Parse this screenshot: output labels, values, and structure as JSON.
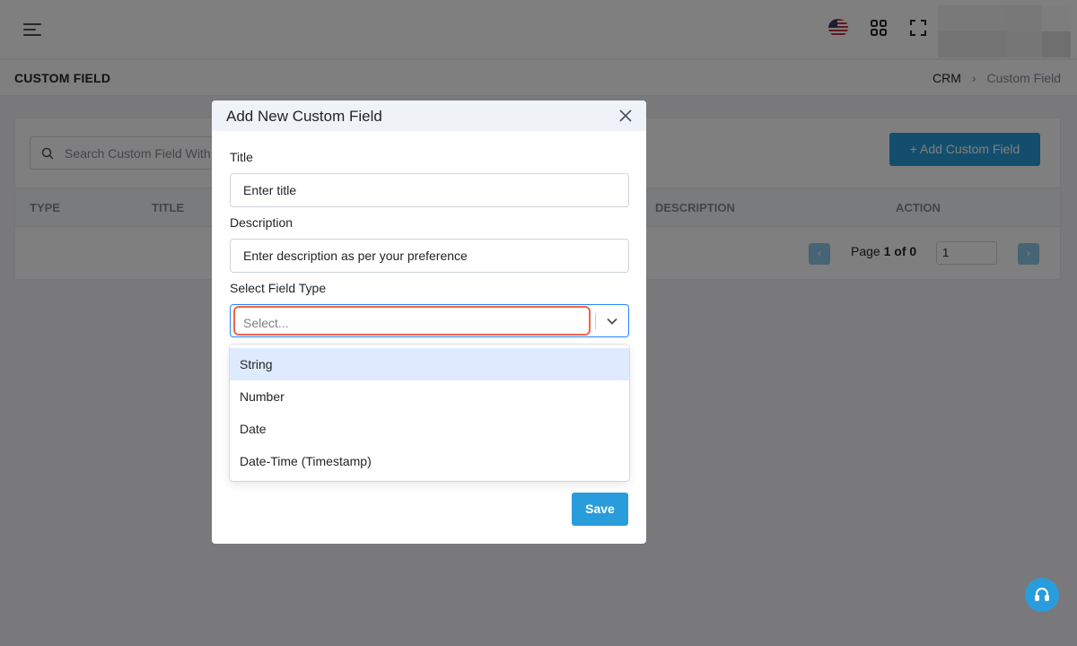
{
  "topbar": {
    "menu_icon": "hamburger-icon",
    "language_flag": "us-flag-icon",
    "apps_icon": "apps-grid-icon",
    "fullscreen_icon": "fullscreen-icon"
  },
  "page": {
    "title": "CUSTOM FIELD",
    "breadcrumb": [
      "CRM",
      "Custom Field"
    ]
  },
  "card": {
    "search_placeholder": "Search Custom Field With...",
    "add_button": "+ Add Custom Field",
    "columns": [
      "TYPE",
      "TITLE",
      "DESCRIPTION",
      "ACTION"
    ],
    "pagination": {
      "prev": "‹",
      "next": "›",
      "page_label": "Page",
      "page_of": "1 of 0",
      "page_input": "1"
    }
  },
  "modal": {
    "title": "Add New Custom Field",
    "title_label": "Title",
    "title_placeholder": "Enter title",
    "description_label": "Description",
    "description_placeholder": "Enter description as per your preference",
    "field_type_label": "Select Field Type",
    "field_type_placeholder": "Select...",
    "field_type_options": [
      "String",
      "Number",
      "Date",
      "Date-Time (Timestamp)"
    ],
    "highlighted_option": "String",
    "save_button": "Save"
  },
  "colors": {
    "primary": "#299cdb",
    "focus_outline": "#f06548",
    "select_border": "#2684ff",
    "option_highlight": "#deebff"
  }
}
